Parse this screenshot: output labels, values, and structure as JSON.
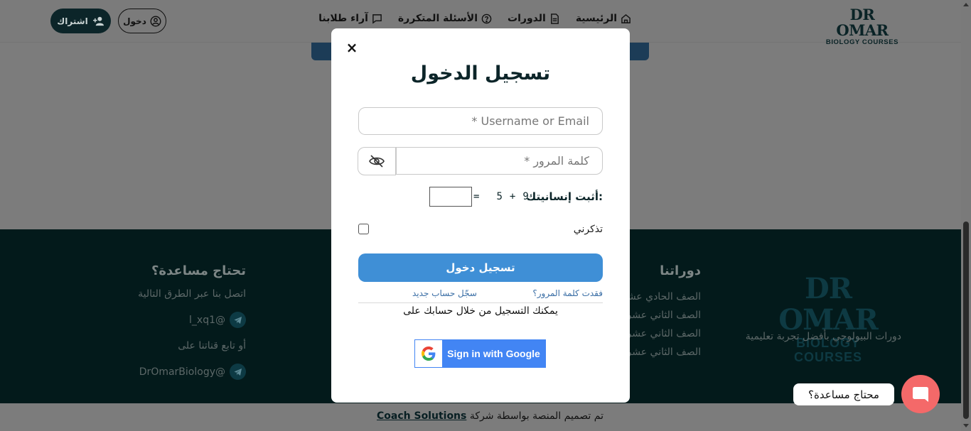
{
  "navbar": {
    "logo_line1": "DR OMAR",
    "logo_line2": "BIOLOGY COURSES",
    "links": [
      "الرئيسية",
      "الدورات",
      "الأسئلة المتكررة",
      "آراء طلابنا"
    ],
    "login_label": "دخول",
    "signup_label": "اشتراك"
  },
  "footer": {
    "logo_line1": "DR OMAR",
    "logo_line2": "BIOLOGY COURSES",
    "tagline": "دورات البيولوجي بأفضل تجربة تعليمية",
    "courses_heading": "دوراتنا",
    "courses": [
      "الصف الحادي عشر",
      "الصف الثاني عشر",
      "الصف الثاني عشر",
      "الصف الثاني عشر"
    ],
    "help_heading": "تحتاج مساعدة؟",
    "help_intro": "اتصل بنا عبر الطرق التالية",
    "telegram_user": "l_xq1@",
    "follow_text": "أو تابع قناتنا على",
    "telegram_channel": "DrOmarBiology@"
  },
  "bottom_bar": {
    "credit_text": "تم تصميم المنصة بواسطة شركة",
    "credit_link": "Coach Solutions"
  },
  "help_widget": {
    "bubble_text": "محتاج مساعدة؟"
  },
  "modal": {
    "close_symbol": "×",
    "title": "تسجيل الدخول",
    "username_placeholder": "* Username or Email",
    "password_placeholder": "كلمة المرور *",
    "captcha_label": "أثبت إنسانيتك:",
    "captcha_a": "9",
    "captcha_op": "+",
    "captcha_b": "5",
    "captcha_eq": "=",
    "remember_label": "تذكرني",
    "remember_checked": false,
    "login_button": "تسجيل دخول",
    "forgot_link": "فقدت كلمة المرور؟",
    "register_link": "سجّل حساب جديد",
    "social_text": "يمكنك التسجيل من خلال حسابك على",
    "google_button": "Sign in with Google"
  },
  "colors": {
    "primary_button": "#3f8fd6",
    "dark_teal": "#0c2529",
    "help_fab": "#f46969",
    "google_blue": "#4285f4"
  }
}
